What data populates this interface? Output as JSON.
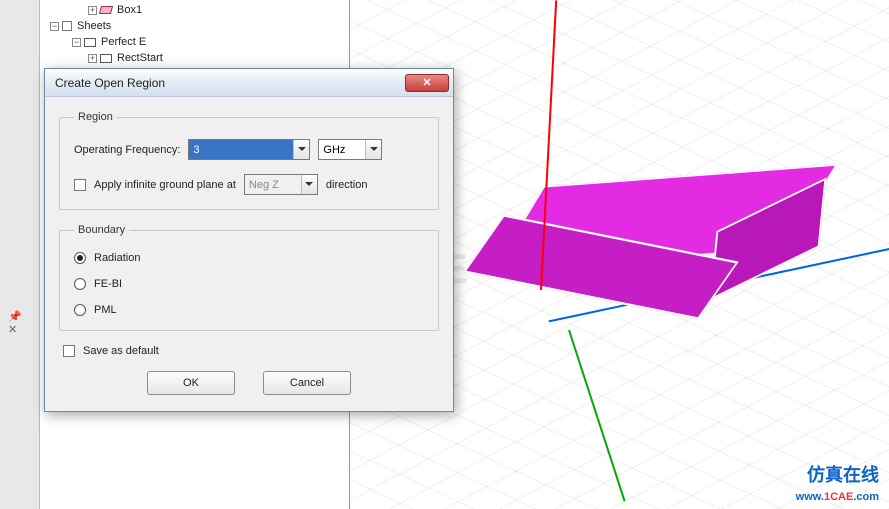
{
  "tree": {
    "box1": "Box1",
    "sheets": "Sheets",
    "perfectE": "Perfect E",
    "rectStart": "RectStart"
  },
  "dialog": {
    "title": "Create Open Region",
    "region": {
      "legend": "Region",
      "freqLabel": "Operating Frequency:",
      "freqValue": "3",
      "freqUnit": "GHz",
      "applyLabel": "Apply infinite ground plane at",
      "planeAxis": "Neg Z",
      "directionLabel": "direction"
    },
    "boundary": {
      "legend": "Boundary",
      "options": [
        "Radiation",
        "FE-BI",
        "PML"
      ],
      "selected": 0
    },
    "saveDefault": "Save as default",
    "ok": "OK",
    "cancel": "Cancel"
  },
  "watermark": {
    "bg": "1CAE",
    "cn": "仿真在线",
    "urlPrefix": "www.",
    "urlMain": "1CAE",
    "urlSuffix": ".com"
  }
}
